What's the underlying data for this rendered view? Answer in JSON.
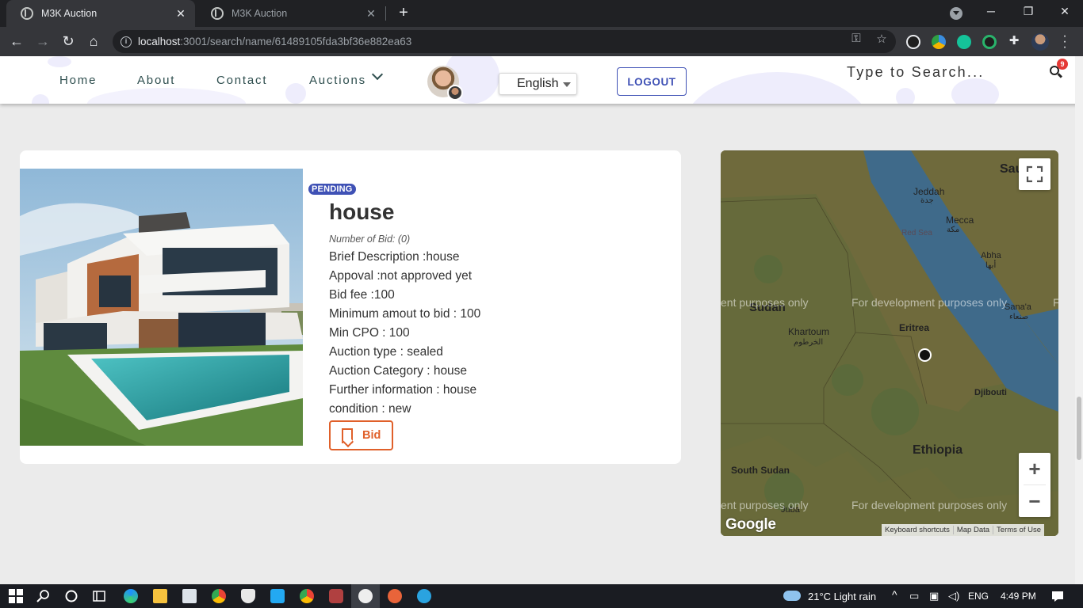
{
  "browser": {
    "tabs": [
      {
        "title": "M3K Auction",
        "active": true
      },
      {
        "title": "M3K Auction",
        "active": false
      }
    ],
    "url_host": "localhost",
    "url_path": ":3001/search/name/61489105fda3bf36e882ea63"
  },
  "header": {
    "nav": [
      "Home",
      "About",
      "Contact",
      "Auctions"
    ],
    "language": "English",
    "logout_label": "LOGOUT",
    "search_placeholder": "Type to Search...",
    "notification_count": "9"
  },
  "item": {
    "status": "PENDING",
    "title": "house",
    "bid_count": "Number of Bid: (0)",
    "details": [
      "Brief Description :house",
      "Appoval :not approved yet",
      "Bid fee :100",
      "Minimum amout to bid : 100",
      "Min CPO : 100",
      "Auction type : sealed",
      "Auction Category : house",
      "Further information : house",
      "condition : new"
    ],
    "bid_label": "Bid"
  },
  "map": {
    "labels": {
      "saudi": "Sau   ra",
      "jeddah": "Jeddah",
      "jeddah_ar": "جدة",
      "mecca": "Mecca",
      "mecca_ar": "مكة",
      "red_sea": "Red Sea",
      "abha": "Abha",
      "abha_ar": "أبها",
      "sudan": "Sudan",
      "khartoum": "Khartoum",
      "khartoum_ar": "الخرطوم",
      "eritrea": "Eritrea",
      "sanaa": "Sana'a",
      "sanaa_ar": "صنعاء",
      "djibouti": "Djibouti",
      "ethiopia": "Ethiopia",
      "south_sudan": "South Sudan",
      "juba": "Juba"
    },
    "dev_notes": [
      "ent purposes only",
      "For development purposes only",
      "F"
    ],
    "footer": [
      "Keyboard shortcuts",
      "Map Data",
      "Terms of Use"
    ],
    "logo": "Google",
    "colors": {
      "land": "#6f6a3c",
      "water": "#3f6a8a"
    }
  },
  "taskbar": {
    "weather": "21°C  Light rain",
    "lang": "ENG",
    "time": "4:49 PM"
  }
}
